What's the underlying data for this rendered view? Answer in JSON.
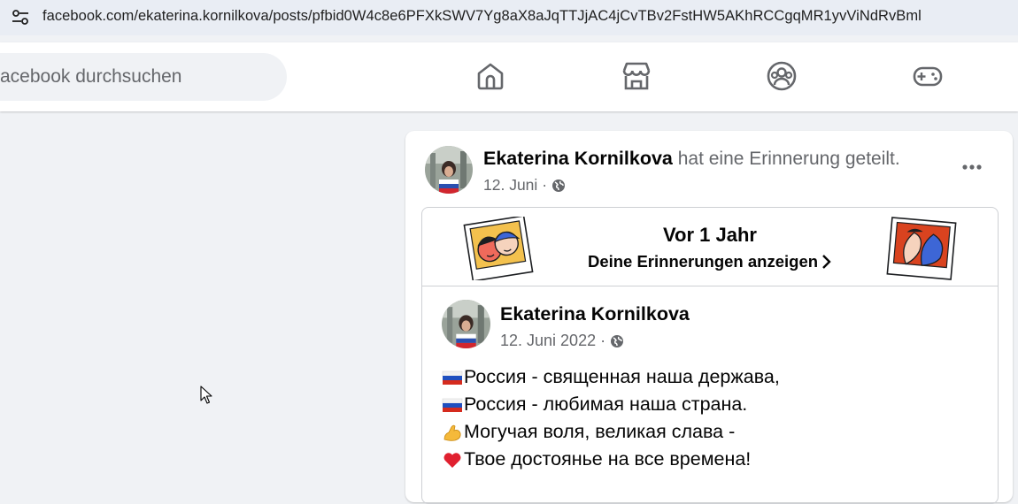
{
  "browser": {
    "url": "facebook.com/ekaterina.kornilkova/posts/pfbid0W4c8e6PFXkSWV7Yg8aX8aJqTTJjAC4jCvTBv2FstHW5AKhRCCgqMR1yvViNdRvBml",
    "site_info_icon": "tune-icon"
  },
  "header": {
    "search_placeholder": "acebook durchsuchen",
    "nav": [
      {
        "name": "home-icon"
      },
      {
        "name": "marketplace-icon"
      },
      {
        "name": "groups-icon"
      },
      {
        "name": "gaming-icon"
      }
    ]
  },
  "post": {
    "author": "Ekaterina Kornilkova",
    "action": " hat eine Erinnerung geteilt.",
    "date": "12. Juni",
    "separator": "·",
    "privacy_icon": "globe-icon",
    "more_icon": "more-horizontal-icon",
    "memory": {
      "title": "Vor 1 Jahr",
      "link": "Deine Erinnerungen anzeigen",
      "inner_author": "Ekaterina Kornilkova",
      "inner_date": "12. Juni 2022",
      "lines": [
        {
          "emoji": "russia-flag-icon",
          "text": "Россия - священная наша держава,"
        },
        {
          "emoji": "russia-flag-icon",
          "text": "Россия - любимая наша страна."
        },
        {
          "emoji": "flexed-biceps-icon",
          "text": "Могучая воля, великая слава -"
        },
        {
          "emoji": "red-heart-icon",
          "text": "Твое достоянье на все времена!"
        }
      ]
    }
  },
  "colors": {
    "page_bg": "#f0f2f5",
    "secondary_text": "#65676b",
    "card_bg": "#ffffff",
    "url_bar_bg": "#e9edf4"
  }
}
